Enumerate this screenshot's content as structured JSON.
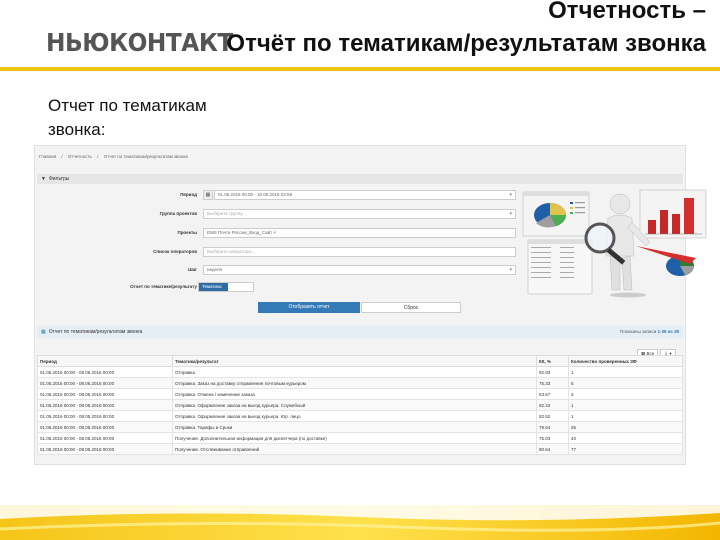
{
  "header": {
    "logo": "НЬЮКОНТАКТ",
    "title_line1": "Отчетность –",
    "title_line2": "Отчёт по тематикам/результатам звонка"
  },
  "subtitle": "Отчет по тематикам звонка:",
  "colors": {
    "accent": "#f1c40f",
    "primary": "#337ab7"
  },
  "app": {
    "breadcrumb": [
      "Главная",
      "/",
      "Отчетность",
      "/",
      "Отчет по тематикам/результатам звонка"
    ],
    "filters_title": "Фильтры",
    "filters": {
      "period_label": "Период",
      "period_value": "01.05.2016 00:00 - 15.05.2016 23:59",
      "project_group_label": "Группа проектов",
      "project_group_placeholder": "Выберите группу...",
      "projects_label": "Проекты",
      "projects_value": "EMS Почта России_Вход_Сайт ×",
      "operators_label": "Список операторов",
      "operators_placeholder": "Выберите оператора...",
      "step_label": "Шаг",
      "step_value": "неделя",
      "report_by_label": "Отчет по тематике/результату",
      "report_by_value": "Тематика"
    },
    "buttons": {
      "show_report": "Отобразить отчет",
      "reset": "Сброс"
    },
    "report_title": "Отчет по тематикам/результатам звонка",
    "paging": {
      "prefix": "Показаны записи",
      "range": "1-38 из 38"
    },
    "tools": {
      "all": "Все",
      "export": "▾"
    },
    "table": {
      "headers": [
        "Период",
        "Тематика/результат",
        "КК, %",
        "Количество проверенных ЗФ"
      ],
      "rows": [
        [
          "01.05.2016 00:00 - 08.05.2016 00:00",
          "Отправка",
          "92.93",
          "1"
        ],
        [
          "01.05.2016 00:00 - 08.05.2016 00:00",
          "Отправка. Заказ на доставку отправления почтовым курьером",
          "75.33",
          "5"
        ],
        [
          "01.05.2016 00:00 - 08.05.2016 00:00",
          "Отправка. Отмена / изменение заказа",
          "53.67",
          "3"
        ],
        [
          "01.05.2016 00:00 - 08.05.2016 00:00",
          "Отправка. Оформление заказа на выезд курьера. Служебный",
          "92.33",
          "1"
        ],
        [
          "01.05.2016 00:00 - 08.05.2016 00:00",
          "Отправка. Оформление заказа на выезд курьера. Юр. лицо",
          "82.52",
          "1"
        ],
        [
          "01.05.2016 00:00 - 08.05.2016 00:00",
          "Отправка. Тарифы и Сроки",
          "79.64",
          "26"
        ],
        [
          "01.05.2016 00:00 - 08.05.2016 00:00",
          "Получение. Дополнительная информация для диспетчера (по доставке)",
          "75.03",
          "40"
        ],
        [
          "01.05.2016 00:00 - 08.05.2016 00:00",
          "Получение. Отслеживание отправлений",
          "80.64",
          "77"
        ]
      ]
    }
  }
}
